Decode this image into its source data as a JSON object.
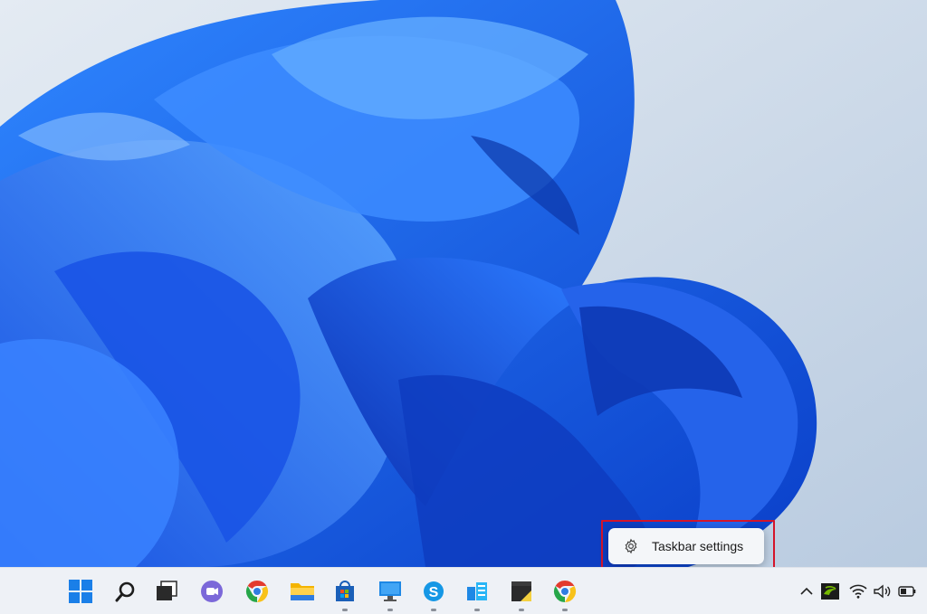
{
  "context_menu": {
    "items": [
      {
        "label": "Taskbar settings",
        "icon": "gear-icon"
      }
    ],
    "highlight_color": "#d4142a"
  },
  "taskbar": {
    "pinned": [
      {
        "name": "start",
        "icon": "windows-logo-icon",
        "running": false
      },
      {
        "name": "search",
        "icon": "search-icon",
        "running": false
      },
      {
        "name": "task-view",
        "icon": "task-view-icon",
        "running": false
      },
      {
        "name": "teams-chat",
        "icon": "chat-icon",
        "running": false
      },
      {
        "name": "chrome",
        "icon": "chrome-icon",
        "running": false
      },
      {
        "name": "file-explorer",
        "icon": "folder-icon",
        "running": false
      },
      {
        "name": "microsoft-store",
        "icon": "store-icon",
        "running": true
      },
      {
        "name": "remote-desktop",
        "icon": "monitor-icon",
        "running": true
      },
      {
        "name": "skype",
        "icon": "skype-icon",
        "running": true
      },
      {
        "name": "azure-data",
        "icon": "database-icon",
        "running": true
      },
      {
        "name": "sticky-notes",
        "icon": "note-icon",
        "running": true
      },
      {
        "name": "chrome-2",
        "icon": "chrome-icon",
        "running": true
      }
    ],
    "tray": [
      {
        "name": "show-hidden",
        "icon": "chevron-up-icon"
      },
      {
        "name": "nvidia",
        "icon": "nvidia-icon"
      },
      {
        "name": "wifi",
        "icon": "wifi-icon"
      },
      {
        "name": "volume",
        "icon": "speaker-icon"
      },
      {
        "name": "battery",
        "icon": "battery-icon"
      }
    ]
  },
  "colors": {
    "wallpaper_bg": "#c9d6e6",
    "bloom_blue": "#1f63f0",
    "taskbar_bg": "#eef1f6"
  }
}
